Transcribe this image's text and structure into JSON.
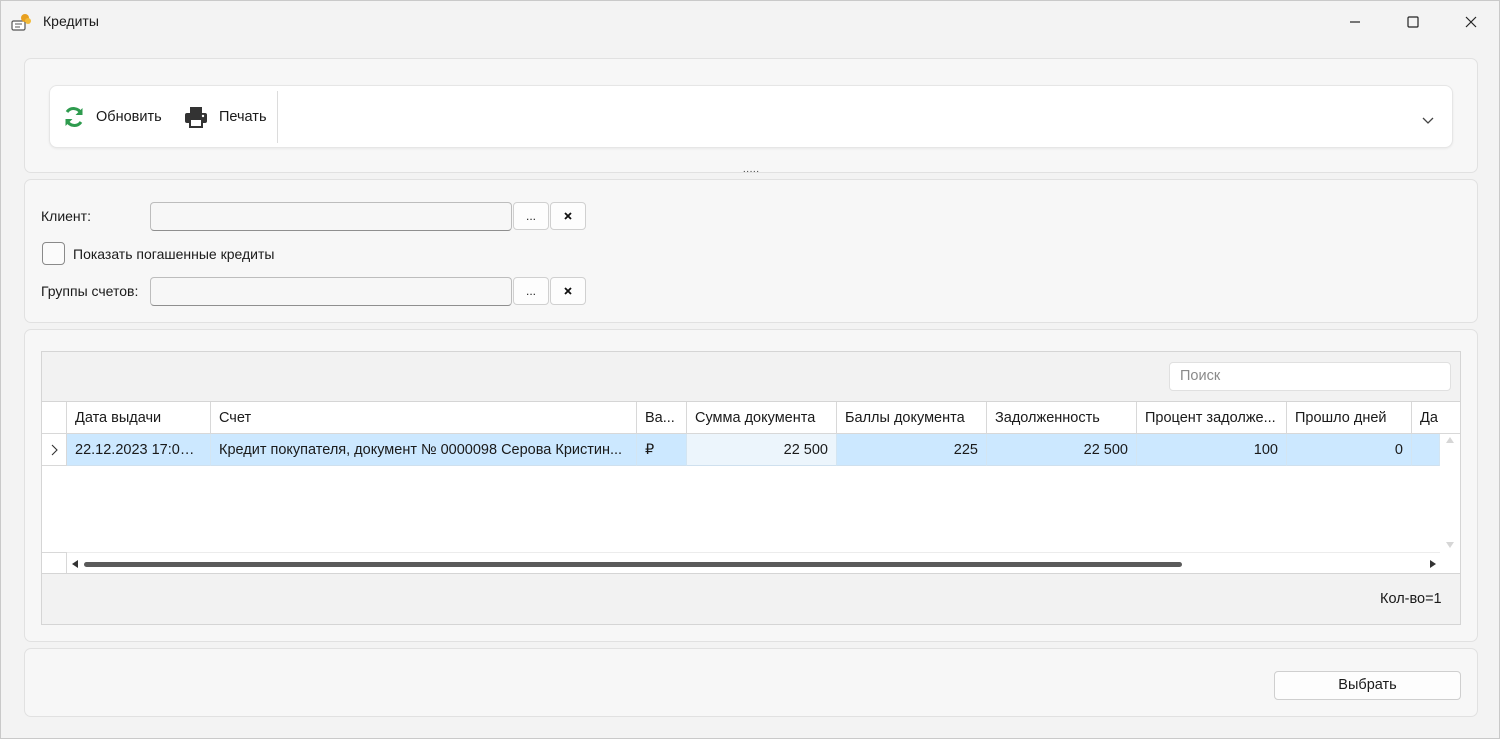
{
  "window": {
    "title": "Кредиты"
  },
  "toolbar": {
    "refresh_label": "Обновить",
    "print_label": "Печать"
  },
  "filters": {
    "client_label": "Клиент:",
    "client_value": "",
    "browse_label": "...",
    "show_repaid_label": "Показать погашенные кредиты",
    "show_repaid_checked": false,
    "account_groups_label": "Группы счетов:",
    "account_groups_value": ""
  },
  "grid": {
    "search_placeholder": "Поиск",
    "columns": [
      "Дата выдачи",
      "Счет",
      "Ва...",
      "Сумма документа",
      "Баллы документа",
      "Задолженность",
      "Процент задолже...",
      "Прошло дней",
      "Да"
    ],
    "rows": [
      [
        "22.12.2023 17:05:...",
        "Кредит покупателя, документ № 0000098 Серова Кристин...",
        "₽",
        "22 500",
        "225",
        "22 500",
        "100",
        "0",
        ""
      ]
    ],
    "count_label": "Кол-во=1"
  },
  "footer": {
    "select_label": "Выбрать"
  },
  "colors": {
    "selection": "#cce8ff",
    "refresh_icon": "#2e9b4e",
    "app_icon": "#e8a020"
  }
}
